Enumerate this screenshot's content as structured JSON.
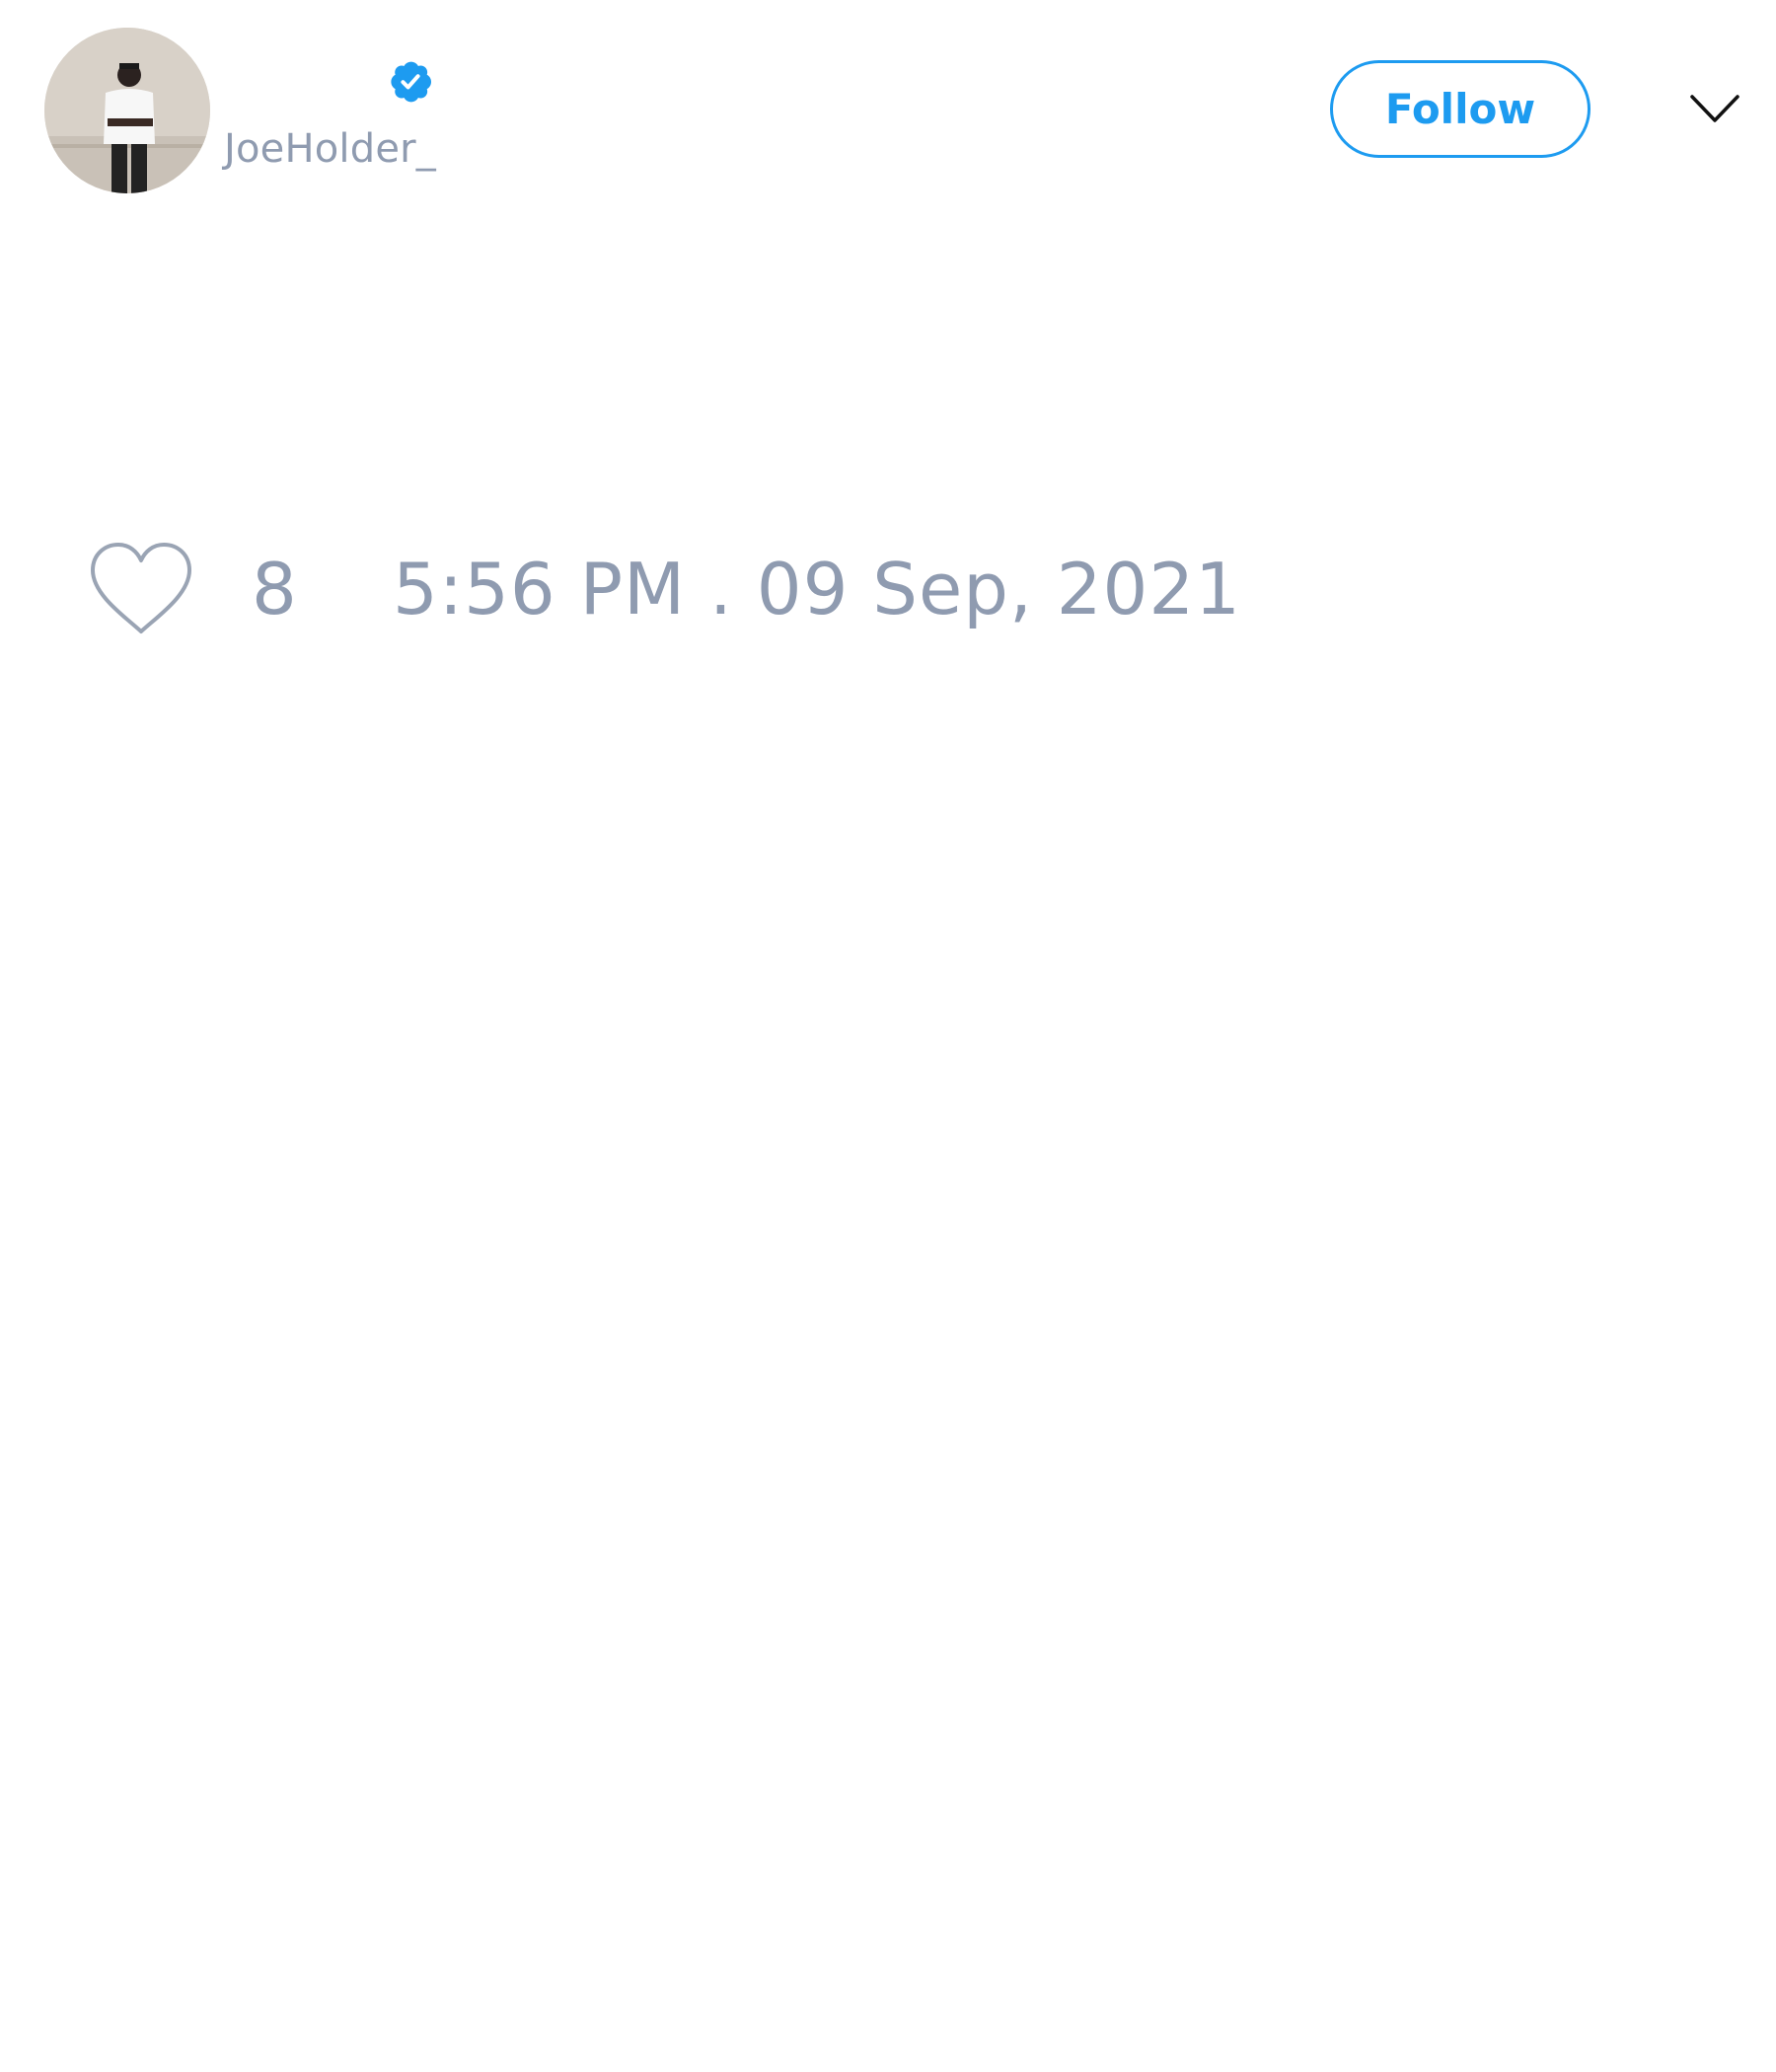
{
  "tweet": {
    "author": {
      "handle": "JoeHolder_",
      "verified": true
    },
    "follow_label": "Follow",
    "likes": "8",
    "timestamp": "5:56 PM . 09 Sep, 2021"
  },
  "colors": {
    "accent": "#1d9bf0",
    "muted_text": "#8f9bb0",
    "background": "#ffffff"
  },
  "icons": {
    "verified": "verified-badge-icon",
    "menu": "chevron-down-icon",
    "like": "heart-icon"
  }
}
